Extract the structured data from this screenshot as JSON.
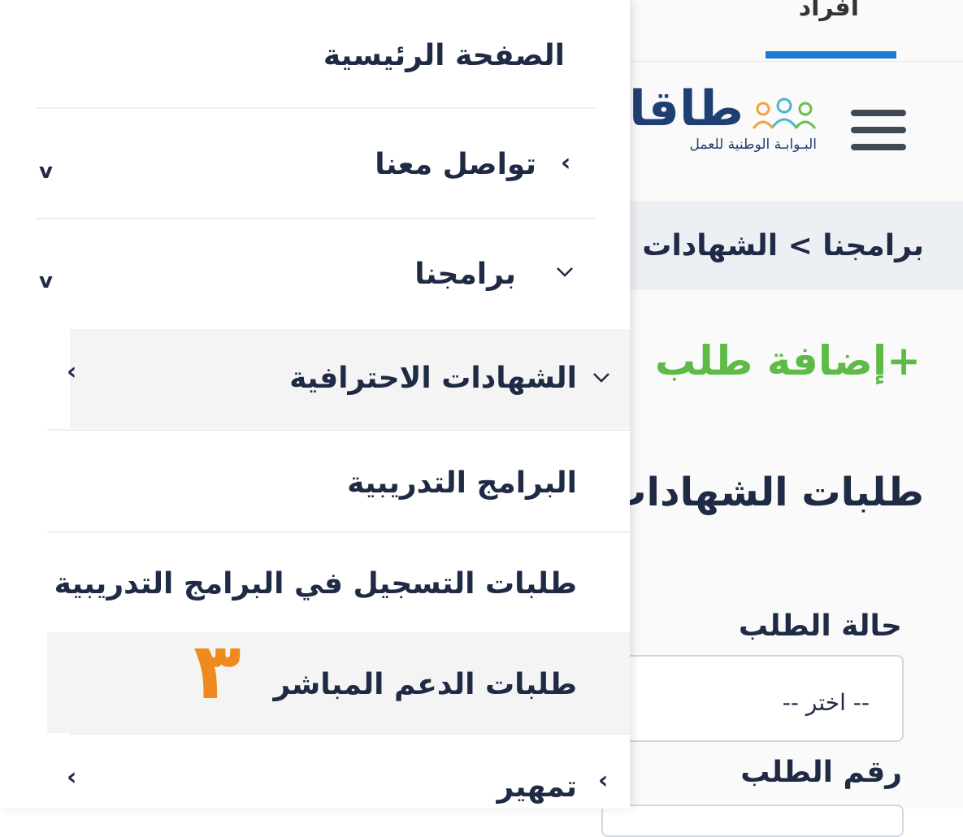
{
  "header": {
    "tab_label": "أفراد",
    "logo_word": "طاقات",
    "logo_subtitle": "البـوابـة الوطنية للعمل"
  },
  "breadcrumb": {
    "text": "برامجنا > الشهادات الاحترافية"
  },
  "page": {
    "add_request": "+إضافة طلب",
    "section_title": "طلبات الشهادات"
  },
  "filters": {
    "status_label": "حالة الطلب",
    "status_value": "-- اختر --",
    "number_label": "رقم الطلب"
  },
  "menu": {
    "home": "الصفحة الرئيسية",
    "contact": "تواصل معنا",
    "programs": "برامجنا",
    "certifications": "الشهادات الاحترافية",
    "training_programs": "البرامج التدريبية",
    "training_registration": "طلبات التسجيل في البرامج التدريبية",
    "direct_support": "طلبات الدعم المباشر",
    "tamheer": "تمهير"
  },
  "annotation": {
    "step_number": "٣"
  },
  "colors": {
    "accent_blue": "#1e7bd6",
    "accent_green": "#5dbb46",
    "annotation_orange": "#f08a1e",
    "text_dark": "#1f2a44"
  },
  "icons": {
    "menu": "hamburger-icon",
    "logo": "people-logo-icon",
    "expand": "chevron-down-icon",
    "submenu": "chevron-left-icon"
  }
}
